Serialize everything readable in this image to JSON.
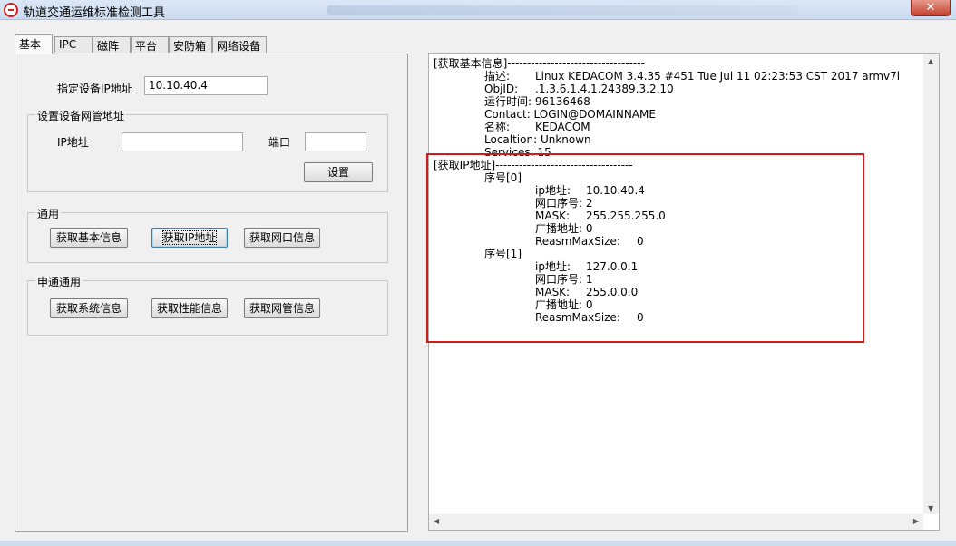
{
  "window": {
    "title": "轨道交通运维标准检测工具",
    "close_label": "✕"
  },
  "tabs": [
    "基本",
    "IPC",
    "磁阵",
    "平台",
    "安防箱",
    "网络设备"
  ],
  "basic": {
    "device_ip_label": "指定设备IP地址",
    "device_ip_value": "10.10.40.4",
    "mgmt_group_title": "设置设备网管地址",
    "ip_label": "IP地址",
    "ip_value": "",
    "port_label": "端口",
    "port_value": "",
    "set_button": "设置",
    "common_group_title": "通用",
    "btn_get_basic_info": "获取基本信息",
    "btn_get_ip": "获取IP地址",
    "btn_get_interface": "获取网口信息",
    "shentong_group_title": "申通通用",
    "btn_get_system": "获取系统信息",
    "btn_get_performance": "获取性能信息",
    "btn_get_netmgmt": "获取网管信息"
  },
  "output": {
    "lines": [
      "[获取基本信息]-----------------------------------",
      "描述:",
      "Linux KEDACOM 3.4.35 #451  Tue Jul 11 02:23:53 CST 2017 armv7l",
      "ObjID:",
      ".1.3.6.1.4.1.24389.3.2.10",
      "运行时间: 96136468",
      "Contact:  LOGIN@DOMAINNAME",
      "名称:",
      "KEDACOM",
      "Localtion: Unknown",
      "Services:  15",
      "[获取IP地址]-----------------------------------",
      "序号[0]",
      "ip地址:",
      "10.10.40.4",
      "网口序号: 2",
      "MASK:",
      "255.255.255.0",
      "广播地址: 0",
      "ReasmMaxSize:",
      "0",
      "序号[1]",
      "ip地址:",
      "127.0.0.1",
      "网口序号: 1",
      "MASK:",
      "255.0.0.0",
      "广播地址: 0",
      "ReasmMaxSize:",
      "0"
    ]
  },
  "colors": {
    "highlight": "#d21b1b",
    "titlebar": "#cbdbf0"
  }
}
